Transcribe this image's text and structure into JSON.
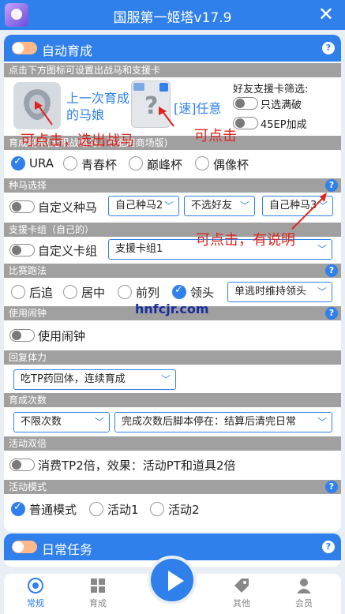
{
  "titlebar": {
    "title": "国服第一姬塔v17.9",
    "close": "✕"
  },
  "auto_train": {
    "header": "自动育成",
    "tip": "点击下方图标可设置出战马和支援卡",
    "last_horse": "上一次育成的马娘",
    "speed_any": "[速]任意",
    "friend_filter_title": "好友支援卡筛选:",
    "only_max_break": "只选满破",
    "ep45": "45EP加成",
    "scenario_section": "育成剧本(无限战略马，不能用商场版)",
    "scenarios": [
      "URA",
      "青春杯",
      "巅峰杯",
      "偶像杯"
    ],
    "scenario_selected": "URA",
    "horse_select_section": "种马选择",
    "custom_horse": "自定义种马",
    "horse_opt1": "自己种马2",
    "horse_opt2": "不选好友",
    "horse_opt3": "自己种马3",
    "support_section": "支援卡组（自己的）",
    "custom_support": "自定义卡组",
    "support_value": "支援卡组1",
    "race_section": "比赛跑法",
    "strategies": [
      "后追",
      "居中",
      "前列",
      "领头"
    ],
    "strategy_selected": "领头",
    "race_keep": "单逃时维持领头",
    "alarm_section": "使用闹钟",
    "alarm_label": "使用闹钟",
    "stamina_section": "回复体力",
    "stamina_value": "吃TP药回体，连续育成",
    "count_section": "育成次数",
    "count_value": "不限次数",
    "after_value": "完成次数后脚本停在：结算后清完日常",
    "double_section": "活动双倍",
    "double_label": "消费TP2倍，效果：活动PT和道具2倍",
    "mode_section": "活动模式",
    "modes": [
      "普通模式",
      "活动1",
      "活动2"
    ],
    "mode_selected": "普通模式"
  },
  "daily": {
    "header": "日常任务"
  },
  "annotations": {
    "a1": "可点击，选出战马",
    "a2": "可点击",
    "a3": "可点击，有说明",
    "watermark": "hnfcjr.com"
  },
  "bottom_nav": {
    "tabs": [
      "常规",
      "育成",
      "其他",
      "会员"
    ],
    "active": "常规"
  },
  "colors": {
    "accent": "#2f80ea",
    "toggle_on": "#ffb98a",
    "annotation": "#e0221c"
  }
}
